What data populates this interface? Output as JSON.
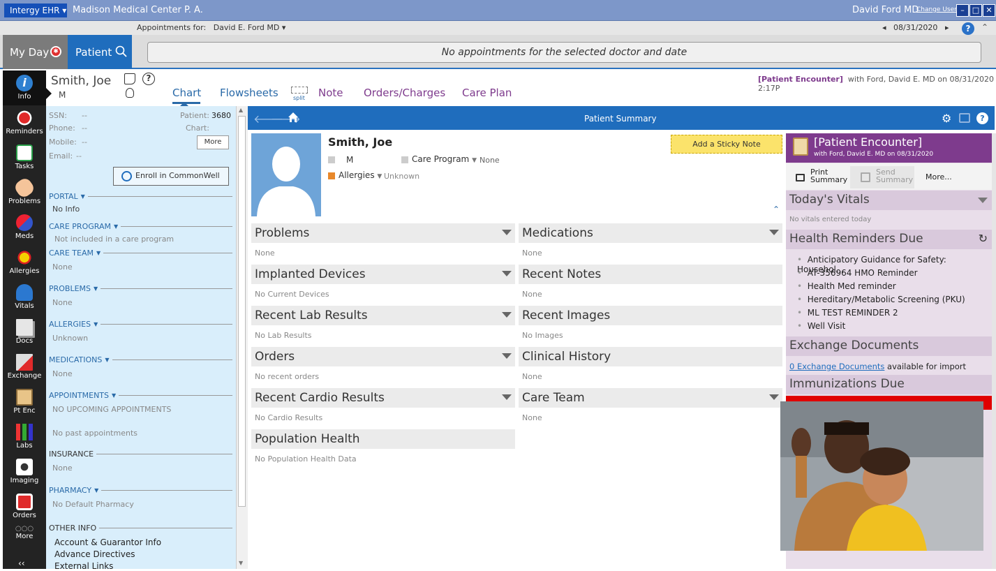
{
  "titlebar": {
    "app_menu": "Intergy EHR",
    "org": "Madison Medical Center P. A.",
    "user": "David Ford MD",
    "change_user": "Change User"
  },
  "appt_bar": {
    "label": "Appointments for:",
    "doctor": "David E. Ford MD",
    "date": "08/31/2020"
  },
  "nav": {
    "my_day": "My Day",
    "patient": "Patient",
    "no_appt_msg": "No appointments for the selected doctor and date"
  },
  "rail": {
    "info": "Info",
    "items": [
      "Reminders",
      "Tasks",
      "Problems",
      "Meds",
      "Allergies",
      "Vitals",
      "Docs",
      "Exchange",
      "Pt Enc",
      "Labs",
      "Imaging",
      "Orders",
      "More"
    ]
  },
  "patient_header": {
    "name": "Smith, Joe",
    "sex": "M",
    "tabs": [
      "Chart",
      "Flowsheets",
      "Note",
      "Orders/Charges",
      "Care Plan"
    ],
    "split": "split",
    "encounter_type": "[Patient Encounter]",
    "encounter_with": "with Ford, David E. MD  on 08/31/2020 2:17P"
  },
  "left_panel": {
    "ssn_label": "SSN:",
    "phone_label": "Phone:",
    "mobile_label": "Mobile:",
    "email_label": "Email:",
    "dash": "--",
    "patient_label": "Patient:",
    "patient_num": "3680",
    "chart_label": "Chart:",
    "more_btn": "More",
    "enroll_btn": "Enroll in CommonWell",
    "sections": [
      {
        "title": "PORTAL",
        "value": "No Info"
      },
      {
        "title": "CARE PROGRAM",
        "value": "Not included in a care program"
      },
      {
        "title": "CARE TEAM",
        "value": "None"
      },
      {
        "title": "PROBLEMS",
        "value": "None"
      },
      {
        "title": "ALLERGIES",
        "value": "Unknown"
      },
      {
        "title": "MEDICATIONS",
        "value": "None"
      },
      {
        "title": "APPOINTMENTS",
        "value": "NO UPCOMING APPOINTMENTS",
        "value2": "No past appointments"
      },
      {
        "title": "INSURANCE",
        "value": "None"
      },
      {
        "title": "PHARMACY",
        "value": "No Default Pharmacy"
      }
    ],
    "other_info": "OTHER INFO",
    "other_links": [
      "Account & Guarantor Info",
      "Advance Directives",
      "External Links"
    ]
  },
  "summary": {
    "title": "Patient Summary",
    "patient_name": "Smith, Joe",
    "sex": "M",
    "care_program": "Care Program",
    "care_program_val": "None",
    "allergies": "Allergies",
    "allergies_val": "Unknown",
    "sticky": "Add a Sticky Note",
    "left_sections": [
      {
        "title": "Problems",
        "value": "None"
      },
      {
        "title": "Implanted Devices",
        "value": "No Current Devices"
      },
      {
        "title": "Recent Lab Results",
        "value": "No Lab Results"
      },
      {
        "title": "Orders",
        "value": "No recent orders"
      },
      {
        "title": "Recent Cardio Results",
        "value": "No Cardio Results"
      },
      {
        "title": "Population Health",
        "value": "No Population Health Data"
      }
    ],
    "right_sections": [
      {
        "title": "Medications",
        "value": "None"
      },
      {
        "title": "Recent Notes",
        "value": "None"
      },
      {
        "title": "Recent Images",
        "value": "No Images"
      },
      {
        "title": "Clinical History",
        "value": "None"
      },
      {
        "title": "Care Team",
        "value": "None"
      }
    ]
  },
  "right_panel": {
    "enc_title": "[Patient Encounter]",
    "enc_sub": "with Ford, David E. MD on 08/31/2020",
    "print": "Print",
    "summary_word": "Summary",
    "send": "Send",
    "more": "More...",
    "vitals_title": "Today's Vitals",
    "vitals_val": "No vitals entered today",
    "reminders_title": "Health Reminders Due",
    "reminders": [
      "Anticipatory Guidance for Safety:  Househol...",
      "AT-356964 HMO Reminder",
      "Health Med reminder",
      "Hereditary/Metabolic Screening (PKU)",
      "ML TEST REMINDER 2",
      "Well Visit"
    ],
    "exchange_title": "Exchange Documents",
    "exchange_link": "0 Exchange Documents",
    "exchange_tail": "available for import",
    "immun_title": "Immunizations Due"
  },
  "colors": {
    "accent": "#1f6dbd",
    "encounter": "#7e3b8d",
    "panel": "#d9eefb"
  }
}
